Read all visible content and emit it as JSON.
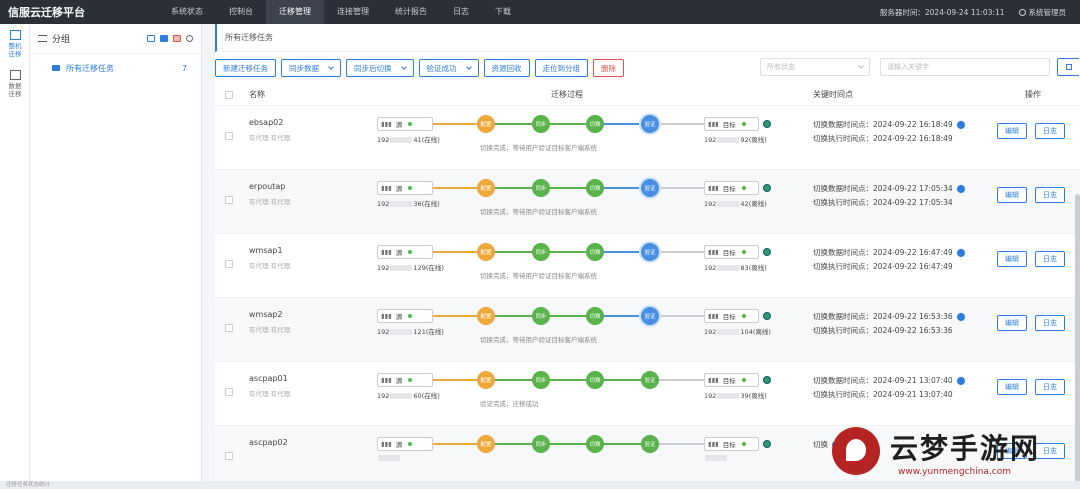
{
  "app": {
    "title": "信服云迁移平台"
  },
  "nav": [
    "系统状态",
    "控制台",
    "迁移管理",
    "连接管理",
    "统计报告",
    "日志",
    "下载"
  ],
  "nav_active": 2,
  "header": {
    "server_time": "服务器时间：2024-09-24 11:03:11",
    "user": "系统管理员"
  },
  "rail": [
    {
      "label": "整机迁移",
      "active": true
    },
    {
      "label": "数据迁移",
      "active": false
    }
  ],
  "groups": {
    "title": "分组",
    "items": [
      {
        "label": "所有迁移任务",
        "count": "7"
      }
    ]
  },
  "breadcrumb": "所有迁移任务",
  "toolbar": {
    "new_task": "新建迁移任务",
    "sync_data": "同步数据",
    "switch_after_sync": "同步后切换",
    "verify_success": "验证成功",
    "release_resources": "资源回收",
    "move_group": "走位到分组",
    "delete": "删除"
  },
  "filter": {
    "status_placeholder": "所有状态",
    "search_placeholder": "请输入关键字"
  },
  "table": {
    "headers": {
      "name": "名称",
      "process": "迁移过程",
      "time": "关键时间点",
      "ops": "操作"
    },
    "source_label": "源",
    "target_label": "目标",
    "steps": [
      "配置",
      "同步",
      "切换",
      "验证"
    ],
    "edit_label": "编辑",
    "log_label": "日志",
    "rows": [
      {
        "name": "ebsap02",
        "sub": "有代理:有代理",
        "src_ip_a": "192",
        "src_ip_b": "41(在线)",
        "dst_ip_a": "192",
        "dst_ip_b": "92(离线)",
        "msg": "切换完成，等待用户验证目标客户端系统",
        "t1": "切换数据时间点：2024-09-22 16:18:49",
        "t2": "切换执行时间点：2024-09-22 16:18:49",
        "verified": false
      },
      {
        "name": "erpoutap",
        "sub": "有代理:有代理",
        "src_ip_a": "192",
        "src_ip_b": "36(在线)",
        "dst_ip_a": "192",
        "dst_ip_b": "42(离线)",
        "msg": "切换完成，等待用户验证目标客户端系统",
        "t1": "切换数据时间点：2024-09-22 17:05:34",
        "t2": "切换执行时间点：2024-09-22 17:05:34",
        "verified": false
      },
      {
        "name": "wmsap1",
        "sub": "有代理:有代理",
        "src_ip_a": "192",
        "src_ip_b": "129(在线)",
        "dst_ip_a": "192",
        "dst_ip_b": "83(离线)",
        "msg": "切换完成，等待用户验证目标客户端系统",
        "t1": "切换数据时间点：2024-09-22 16:47:49",
        "t2": "切换执行时间点：2024-09-22 16:47:49",
        "verified": false
      },
      {
        "name": "wmsap2",
        "sub": "有代理:有代理",
        "src_ip_a": "192",
        "src_ip_b": "121(在线)",
        "dst_ip_a": "192",
        "dst_ip_b": "104(离线)",
        "msg": "切换完成，等待用户验证目标客户端系统",
        "t1": "切换数据时间点：2024-09-22 16:53:36",
        "t2": "切换执行时间点：2024-09-22 16:53:36",
        "verified": false
      },
      {
        "name": "ascpap01",
        "sub": "有代理:有代理",
        "src_ip_a": "192",
        "src_ip_b": "60(在线)",
        "dst_ip_a": "192",
        "dst_ip_b": "39(离线)",
        "msg": "验证完成，迁移成功",
        "t1": "切换数据时间点：2024-09-21 13:07:40",
        "t2": "切换执行时间点：2024-09-21 13:07:40",
        "verified": true
      },
      {
        "name": "ascpap02",
        "sub": "",
        "src_ip_a": "",
        "src_ip_b": "",
        "dst_ip_a": "",
        "dst_ip_b": "",
        "msg": "",
        "t1": "切换",
        "t2": "",
        "verified": true
      }
    ]
  },
  "status_bar": "迁移任务状态统计",
  "watermark": {
    "text": "云梦手游网",
    "url": "www.yunmengchina.com"
  },
  "colors": {
    "accent": "#2d7de0",
    "config": "#f0a73a",
    "done": "#5ab24a",
    "active": "#4a90e2",
    "danger": "#d9534f"
  }
}
